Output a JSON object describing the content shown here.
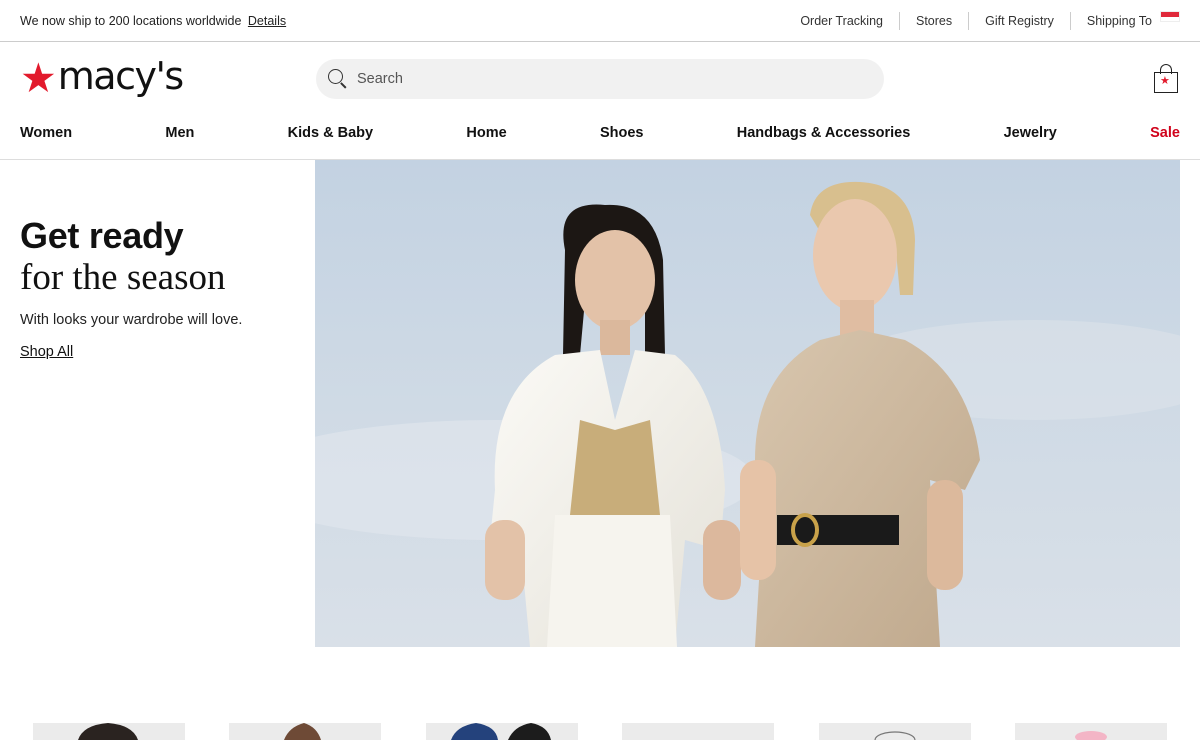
{
  "utility": {
    "ship_message": "We now ship to 200 locations worldwide",
    "details_link": "Details",
    "links": [
      "Order Tracking",
      "Stores",
      "Gift Registry"
    ],
    "shipping_label": "Shipping To"
  },
  "header": {
    "logo_text": "macy's",
    "search_placeholder": "Search"
  },
  "nav": {
    "items": [
      "Women",
      "Men",
      "Kids & Baby",
      "Home",
      "Shoes",
      "Handbags & Accessories",
      "Jewelry",
      "Sale"
    ]
  },
  "hero": {
    "title": "Get ready",
    "subtitle": "for the season",
    "description": "With looks your wardrobe will love.",
    "cta": "Shop All"
  },
  "colors": {
    "brand_red": "#e21a2c",
    "sale_red": "#d0021b",
    "search_bg": "#f1f1f1"
  },
  "icons": [
    "search-icon",
    "shopping-bag-icon",
    "singapore-flag-icon",
    "macys-star-icon"
  ]
}
